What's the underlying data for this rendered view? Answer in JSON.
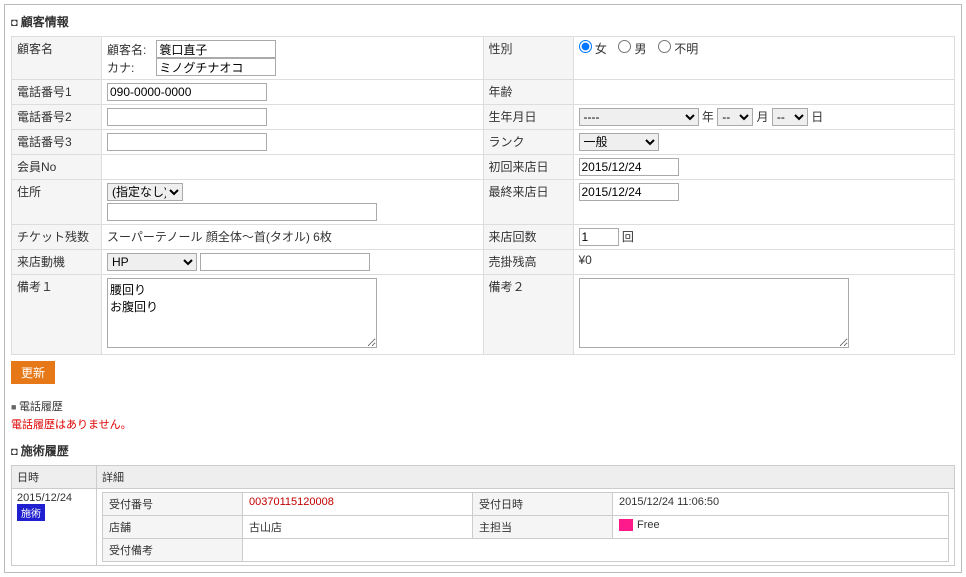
{
  "section": {
    "customer_info": "顧客情報",
    "phone_history": "電話履歴",
    "treatment_history": "施術履歴"
  },
  "no_phone_history": "電話履歴はありません。",
  "labels": {
    "customer_name": "顧客名",
    "customer_name_field": "顧客名:",
    "kana_field": "カナ:",
    "phone1": "電話番号1",
    "phone2": "電話番号2",
    "phone3": "電話番号3",
    "member_no": "会員No",
    "address": "住所",
    "ticket_remain": "チケット残数",
    "visit_motive": "来店動機",
    "remark1": "備考１",
    "gender": "性別",
    "age": "年齢",
    "birthdate": "生年月日",
    "rank": "ランク",
    "first_visit": "初回来店日",
    "last_visit": "最終来店日",
    "visit_count": "来店回数",
    "ar_balance": "売掛残高",
    "remark2": "備考２",
    "year": "年",
    "month": "月",
    "day": "日",
    "times": "回",
    "gender_f": "女",
    "gender_m": "男",
    "gender_u": "不明",
    "update": "更新",
    "datetime": "日時",
    "detail": "詳細",
    "receipt_no": "受付番号",
    "receipt_datetime": "受付日時",
    "store": "店舗",
    "main_staff": "主担当",
    "receipt_remark": "受付備考"
  },
  "values": {
    "customer_name": "簑口直子",
    "kana": "ミノグチナオコ",
    "phone1": "090-0000-0000",
    "phone2": "",
    "phone3": "",
    "member_no": "",
    "address_pref": "(指定なし)",
    "address": "",
    "ticket_remain": "スーパーテノール 顔全体～首(タオル)   6枚",
    "visit_motive": "HP",
    "visit_motive_detail": "",
    "remark1": "腰回り\nお腹回り",
    "gender": "f",
    "age": "",
    "birth_year": "----",
    "birth_month": "--",
    "birth_day": "--",
    "rank": "一般",
    "first_visit": "2015/12/24",
    "last_visit": "2015/12/24",
    "visit_count": "1",
    "ar_balance": "¥0",
    "remark2": ""
  },
  "history": {
    "date": "2015/12/24",
    "tag": "施術",
    "receipt_no": "00370115120008",
    "receipt_datetime": "2015/12/24 11:06:50",
    "store": "古山店",
    "main_staff": "Free",
    "receipt_remark": ""
  }
}
